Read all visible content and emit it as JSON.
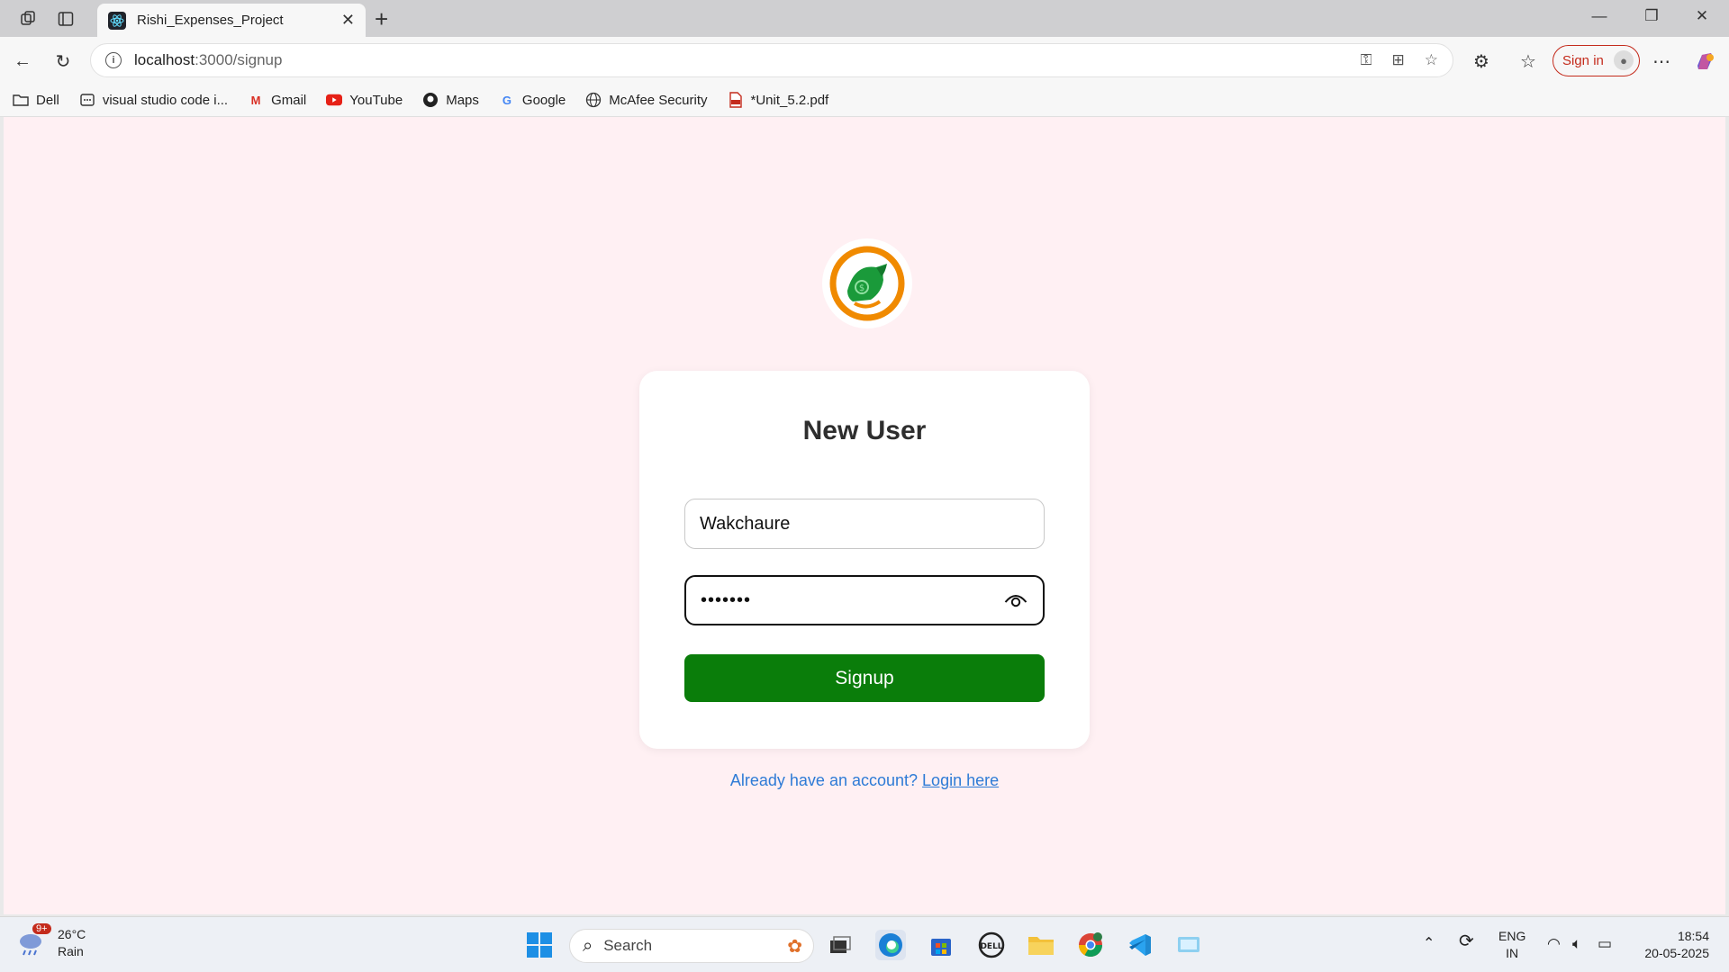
{
  "browser": {
    "tab_title": "Rishi_Expenses_Project",
    "url_host": "localhost",
    "url_path": ":3000/signup",
    "signin_label": "Sign in"
  },
  "bookmarks": [
    {
      "label": "Dell",
      "icon": "folder-icon"
    },
    {
      "label": "visual studio code i...",
      "icon": "app-icon"
    },
    {
      "label": "Gmail",
      "icon": "gmail-icon"
    },
    {
      "label": "YouTube",
      "icon": "youtube-icon"
    },
    {
      "label": "Maps",
      "icon": "github-icon"
    },
    {
      "label": "Google",
      "icon": "google-icon"
    },
    {
      "label": "McAfee Security",
      "icon": "globe-icon"
    },
    {
      "label": "*Unit_5.2.pdf",
      "icon": "pdf-icon"
    }
  ],
  "signup": {
    "heading": "New User",
    "username_value": "Wakchaure",
    "password_masked": "•••••••",
    "submit_label": "Signup",
    "login_prompt": "Already have an account?",
    "login_link": "Login here"
  },
  "taskbar": {
    "weather_temp": "26°C",
    "weather_desc": "Rain",
    "weather_badge": "9+",
    "search_placeholder": "Search",
    "lang_top": "ENG",
    "lang_bottom": "IN",
    "time": "18:54",
    "date": "20-05-2025"
  },
  "colors": {
    "page_bg": "#fff0f3",
    "submit_green": "#0a7d0a",
    "link_blue": "#2e7bd6",
    "signin_red": "#c42b1c"
  }
}
